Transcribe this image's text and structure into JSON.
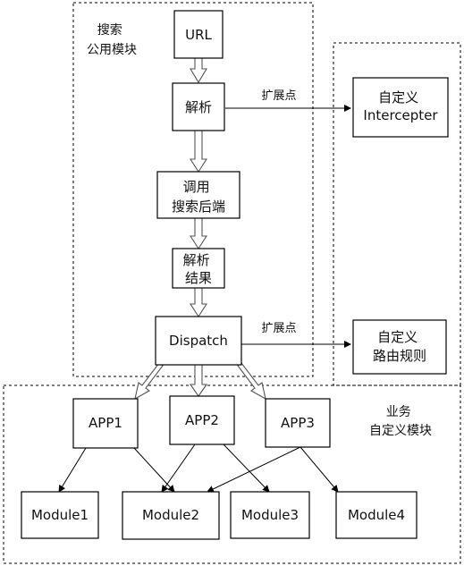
{
  "groups": {
    "search_common": [
      "搜索",
      "公用模块"
    ],
    "business_custom": [
      "业务",
      "自定义模块"
    ]
  },
  "nodes": {
    "url": [
      "URL"
    ],
    "parse": [
      "解析"
    ],
    "call_backend": [
      "调用",
      "搜索后端"
    ],
    "parse_result": [
      "解析",
      "结果"
    ],
    "dispatch": [
      "Dispatch"
    ],
    "custom_interceptor": [
      "自定义",
      "Intercepter"
    ],
    "custom_routing": [
      "自定义",
      "路由规则"
    ],
    "app1": [
      "APP1"
    ],
    "app2": [
      "APP2"
    ],
    "app3": [
      "APP3"
    ],
    "module1": [
      "Module1"
    ],
    "module2": [
      "Module2"
    ],
    "module3": [
      "Module3"
    ],
    "module4": [
      "Module4"
    ]
  },
  "edge_labels": {
    "parse_extension": "扩展点",
    "dispatch_extension": "扩展点"
  }
}
